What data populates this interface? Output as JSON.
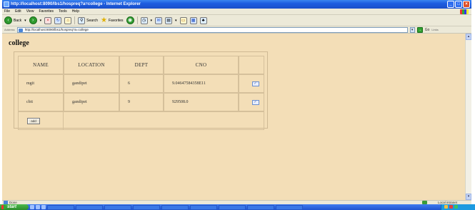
{
  "window": {
    "title": "http://localhost:8090/lbs1/hospreq?a=college - Internet Explorer"
  },
  "menu": [
    "File",
    "Edit",
    "View",
    "Favorites",
    "Tools",
    "Help"
  ],
  "toolbar": {
    "back_label": "Back",
    "search_label": "Search",
    "favorites_label": "Favorites"
  },
  "address": {
    "label": "Address",
    "url": "http://localhost:8090/lbs1/hospreq?a=college",
    "go_label": "Go",
    "links_label": "Links"
  },
  "page": {
    "title": "college",
    "columns": [
      "NAME",
      "LOCATION",
      "DEPT",
      "CNO"
    ],
    "rows": [
      {
        "name": "mgit",
        "location": "gandipet",
        "dept": "6",
        "cno": "9.04647584358E11"
      },
      {
        "name": "cbit",
        "location": "gandipet",
        "dept": "9",
        "cno": "929508.0"
      }
    ],
    "add_label": "add"
  },
  "status": {
    "left": "Done",
    "right": "Local intranet"
  },
  "taskbar": {
    "start_label": "start"
  },
  "icons": {
    "back": "back-arrow-icon",
    "forward": "forward-arrow-icon",
    "stop": "stop-icon",
    "refresh": "refresh-icon",
    "home": "home-icon",
    "search": "search-icon",
    "favorites": "star-icon",
    "edit": "edit-icon"
  },
  "colors": {
    "page_background": "#f3deb7",
    "titlebar": "#1d5de0",
    "chrome": "#ece9d8"
  }
}
